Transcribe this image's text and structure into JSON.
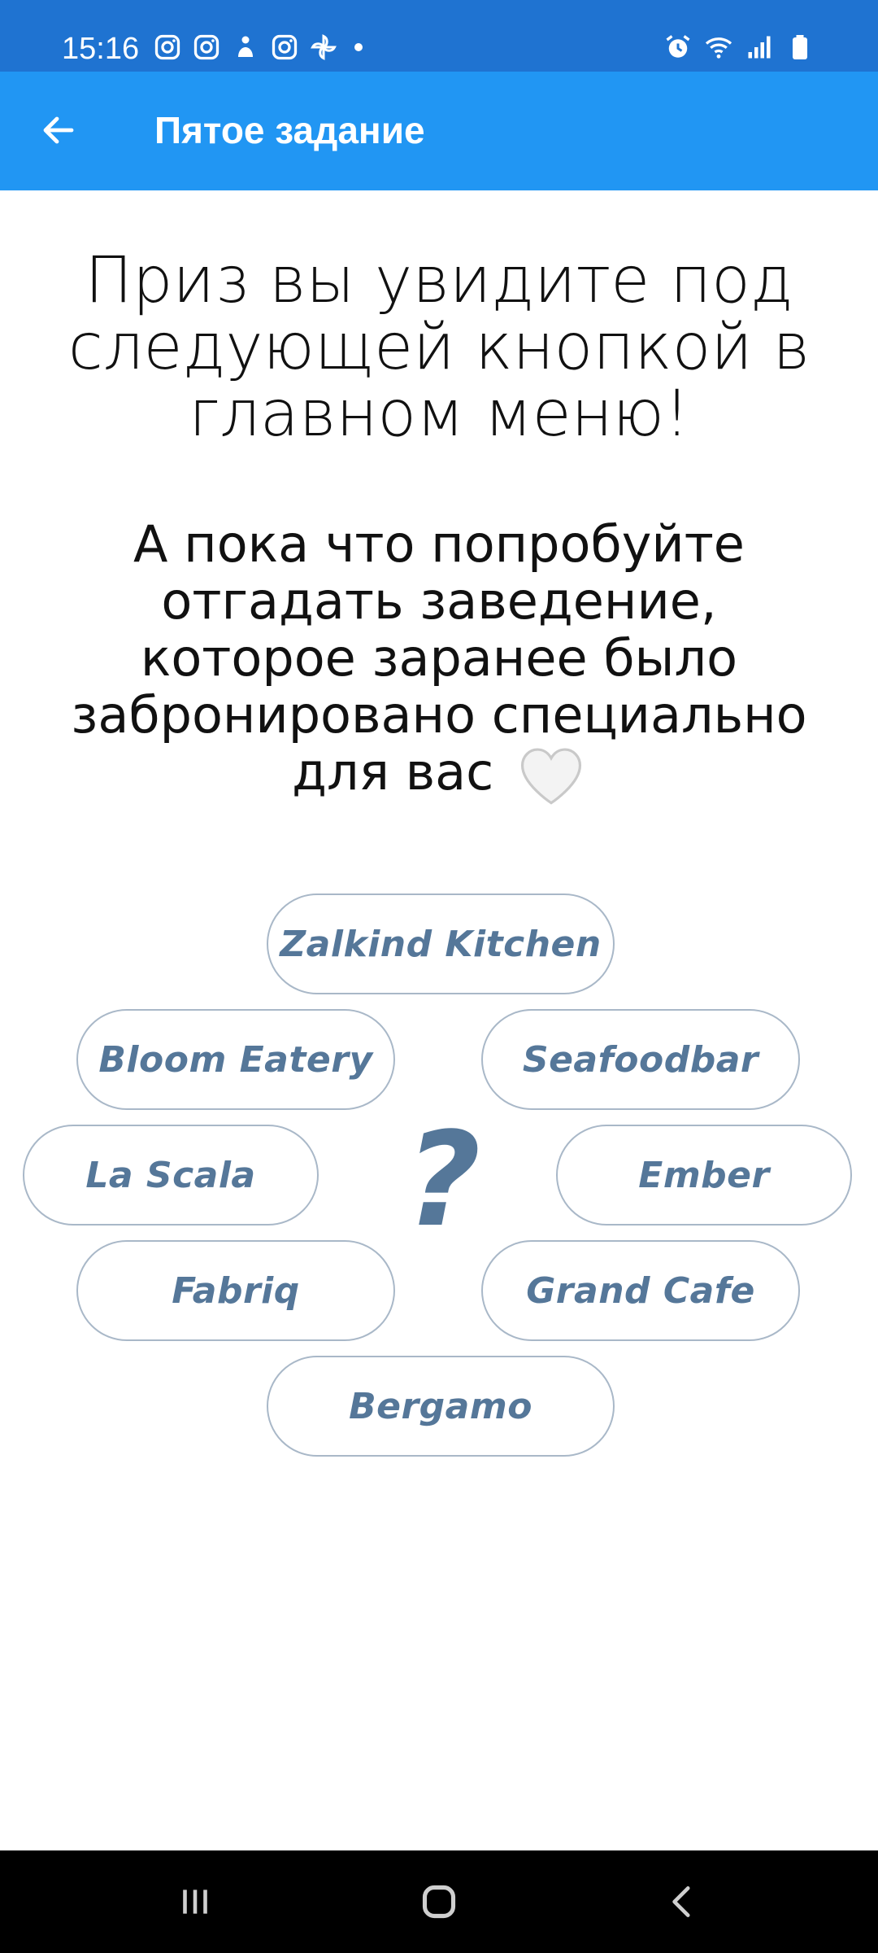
{
  "status_bar": {
    "time": "15:16",
    "left_icons": [
      "instagram-icon",
      "instagram-icon",
      "app-icon",
      "instagram-icon",
      "pinwheel-icon"
    ],
    "right_icons": [
      "alarm-icon",
      "wifi-icon",
      "signal-icon",
      "battery-icon"
    ]
  },
  "app_bar": {
    "title": "Пятое задание",
    "back_icon": "arrow-left-icon",
    "color": "#2196f3"
  },
  "content": {
    "heading": "Приз вы увидите под следующей кнопкой в главном меню!",
    "subtext": "А пока что попробуйте отгадать заведение, которое заранее было забронировано специально для вас",
    "heart_icon": "white-heart-icon",
    "question_mark": "?",
    "options": [
      "Zalkind Kitchen",
      "Bloom Eatery",
      "Seafoodbar",
      "La Scala",
      "Ember",
      "Fabriq",
      "Grand Cafe",
      "Bergamo"
    ],
    "accent_color": "#557799"
  },
  "nav_bar": {
    "buttons": [
      "recent-apps-icon",
      "home-icon",
      "back-icon"
    ]
  }
}
